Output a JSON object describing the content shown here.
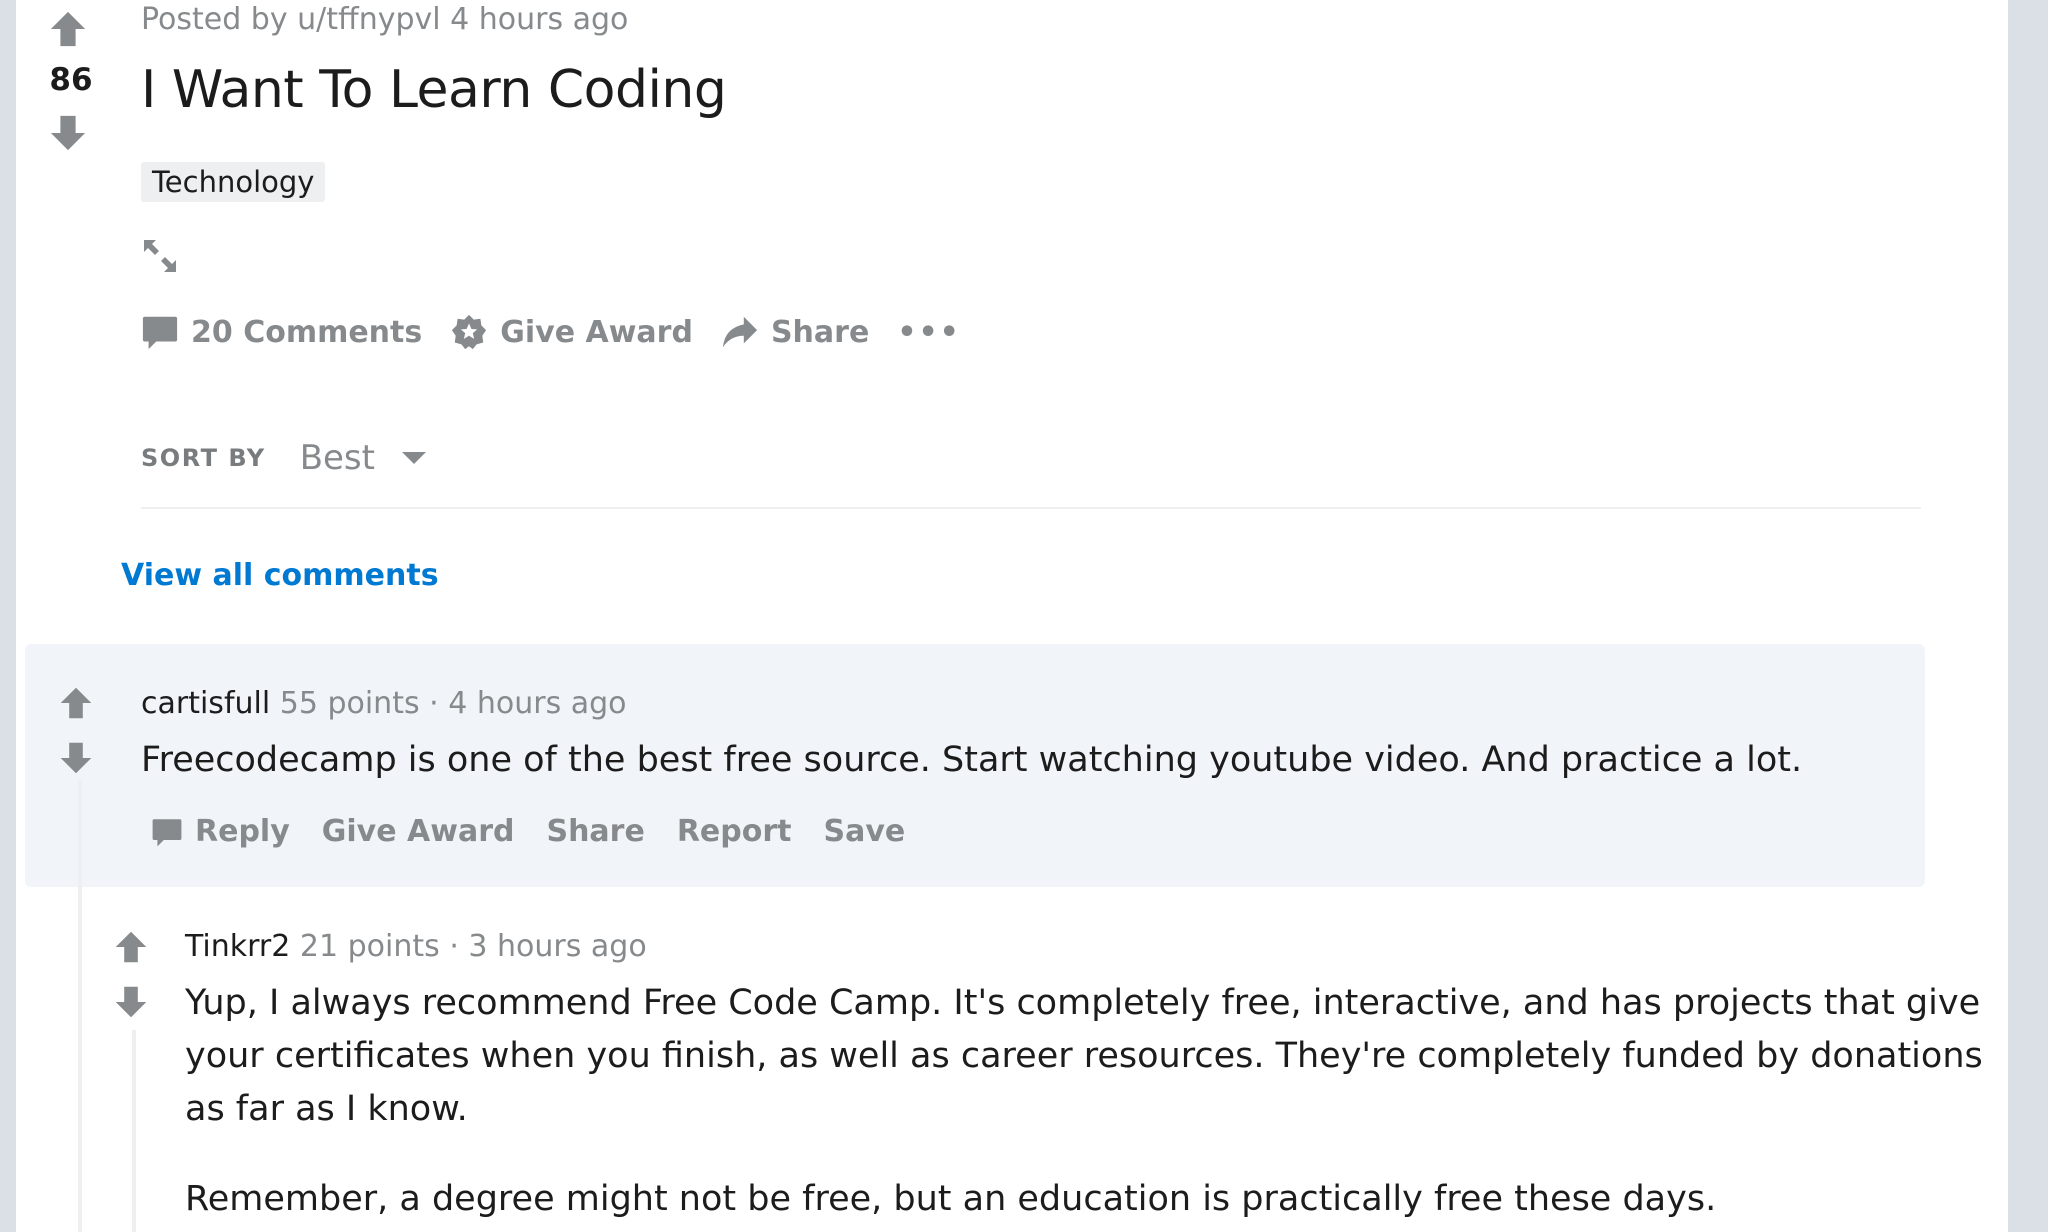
{
  "post": {
    "meta": "Posted by u/tffnypvl 4 hours ago",
    "votes": "86",
    "title": "I Want To Learn Coding",
    "flair": "Technology",
    "actions": {
      "comments": "20 Comments",
      "award": "Give Award",
      "share": "Share",
      "more": "•••"
    }
  },
  "sort": {
    "label": "SORT BY",
    "value": "Best"
  },
  "view_all": "View all comments",
  "comments": [
    {
      "author": "cartisfull",
      "points": "55 points",
      "sep": "·",
      "time": "4 hours ago",
      "body": "Freecodecamp is one of the best free source. Start watching youtube video. And practice a lot.",
      "actions": [
        "Reply",
        "Give Award",
        "Share",
        "Report",
        "Save"
      ]
    },
    {
      "author": "Tinkrr2",
      "points": "21 points",
      "sep": "·",
      "time": "3 hours ago",
      "body_lines": [
        "Yup, I always recommend Free Code Camp. It's completely free, interactive, and has projects that give",
        "your certificates when you finish, as well as career resources. They're completely funded by donations",
        "as far as I know."
      ],
      "body_2": "Remember, a degree might not be free, but an education is practically free these days."
    }
  ],
  "colors": {
    "page_bg": "#dae0e6",
    "card_bg": "#ffffff",
    "highlight_bg": "#f1f5fa",
    "link": "#0079d3",
    "muted": "#878a8c",
    "text": "#1c1c1c"
  },
  "icons": [
    "upvote-icon",
    "downvote-icon",
    "expand-icon",
    "comment-icon",
    "award-icon",
    "share-icon",
    "caret-down-icon"
  ]
}
